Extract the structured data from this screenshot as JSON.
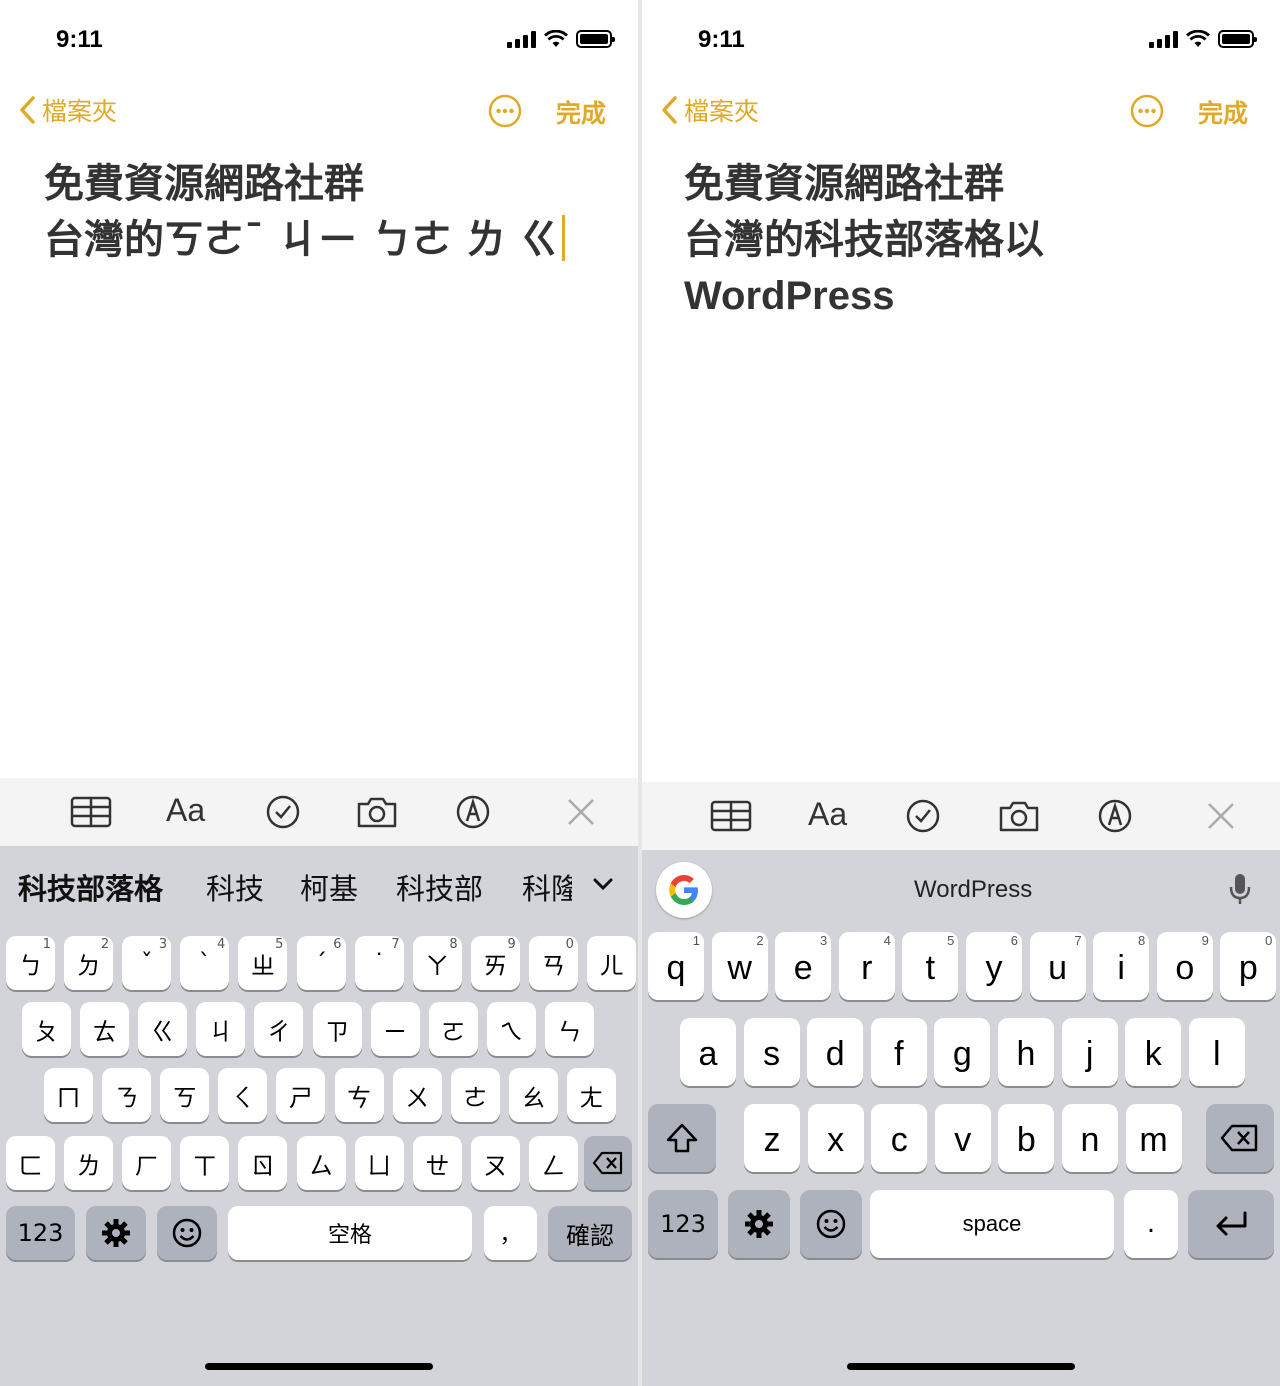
{
  "status_bar": {
    "time": "9:11"
  },
  "nav": {
    "back_label": "檔案夾",
    "done_label": "完成"
  },
  "left": {
    "note_title": "免費資源網路社群",
    "note_body": "台灣的ㄎㄜˉ ㄐㄧ ㄅㄜ ㄌ ㄍ",
    "candidates": [
      "科技部落格",
      "科技",
      "柯基",
      "科技部",
      "科隆"
    ],
    "rows": [
      [
        "ㄅ",
        "ㄉ",
        "ˇ",
        "ˋ",
        "ㄓ",
        "ˊ",
        "˙",
        "ㄚ",
        "ㄞ",
        "ㄢ",
        "ㄦ"
      ],
      [
        "ㄆ",
        "ㄊ",
        "ㄍ",
        "ㄐ",
        "ㄔ",
        "ㄗ",
        "ㄧ",
        "ㄛ",
        "ㄟ",
        "ㄣ"
      ],
      [
        "ㄇ",
        "ㄋ",
        "ㄎ",
        "ㄑ",
        "ㄕ",
        "ㄘ",
        "ㄨ",
        "ㄜ",
        "ㄠ",
        "ㄤ"
      ],
      [
        "ㄈ",
        "ㄌ",
        "ㄏ",
        "ㄒ",
        "ㄖ",
        "ㄙ",
        "ㄩ",
        "ㄝ",
        "ㄡ",
        "ㄥ"
      ]
    ],
    "row1_numbers": [
      "1",
      "2",
      "3",
      "4",
      "5",
      "6",
      "7",
      "8",
      "9",
      "0",
      ""
    ],
    "bottom": {
      "numbers": "123",
      "space": "空格",
      "comma": "，",
      "confirm": "確認"
    }
  },
  "right": {
    "note_title": "免費資源網路社群",
    "note_body": "台灣的科技部落格以",
    "note_body2": "WordPress",
    "suggestion": "WordPress",
    "rows": [
      [
        "q",
        "w",
        "e",
        "r",
        "t",
        "y",
        "u",
        "i",
        "o",
        "p"
      ],
      [
        "a",
        "s",
        "d",
        "f",
        "g",
        "h",
        "j",
        "k",
        "l"
      ],
      [
        "z",
        "x",
        "c",
        "v",
        "b",
        "n",
        "m"
      ]
    ],
    "row1_numbers": [
      "1",
      "2",
      "3",
      "4",
      "5",
      "6",
      "7",
      "8",
      "9",
      "0"
    ],
    "bottom": {
      "numbers": "123",
      "space": "space",
      "period": "."
    }
  },
  "colors": {
    "accent": "#dfaa27",
    "keyboard_bg": "#d2d4da",
    "toolbar_bg": "#f4f4f5"
  },
  "icons": [
    "signal-icon",
    "wifi-icon",
    "battery-icon",
    "chevron-left-icon",
    "more-icon",
    "table-icon",
    "text-format-icon",
    "checklist-icon",
    "camera-icon",
    "markup-icon",
    "close-icon",
    "gear-icon",
    "emoji-icon",
    "delete-icon",
    "shift-icon",
    "return-icon",
    "google-icon",
    "microphone-icon"
  ]
}
